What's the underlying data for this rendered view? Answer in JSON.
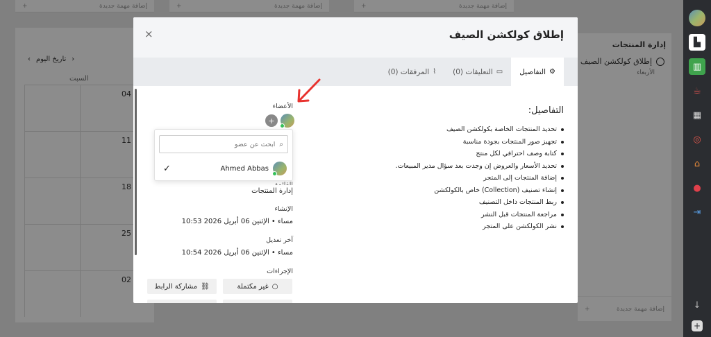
{
  "background": {
    "top_cards": [
      "إضافة مهمة جديدة",
      "إضافة مهمة جديدة",
      "إضافة مهمة جديدة"
    ],
    "calendar": {
      "today_label": "تاريخ اليوم",
      "day_header": "السبت",
      "dates": [
        "04",
        "11",
        "18",
        "25",
        "02"
      ]
    },
    "right_panel": {
      "title": "إدارة المنتجات",
      "task_title": "إطلاق كولكشن الصيف",
      "task_meta": "الأربعاء",
      "add_task": "إضافة مهمة جديدة"
    }
  },
  "sidebar": {
    "icons": [
      "avatar-icon",
      "dashboard-icon",
      "map-icon",
      "coffee-icon",
      "checkered-flag-icon",
      "target-icon",
      "house-icon",
      "pin-icon",
      "import-icon",
      "download-icon",
      "add-icon"
    ]
  },
  "modal": {
    "title": "إطلاق كولكشن الصيف",
    "close_symbol": "×",
    "tabs": [
      {
        "label": "التفاصيل",
        "icon": "gear-icon",
        "active": true
      },
      {
        "label": "التعليقات (0)",
        "icon": "comment-icon",
        "active": false
      },
      {
        "label": "المرفقات (0)",
        "icon": "paperclip-icon",
        "active": false
      }
    ],
    "details": {
      "title": "التفاصيل:",
      "items": [
        "تحديد المنتجات الخاصة بكولكشن الصيف",
        "تجهيز صور المنتجات بجودة مناسبة",
        "كتابة وصف احترافي لكل منتج",
        "تحديد الأسعار والعروض إن وجدت بعد سؤال مدير المبيعات.",
        "إضافة المنتجات إلى المتجر",
        "إنشاء تصنيف (Collection) خاص بالكولكشن",
        "ربط المنتجات داخل التصنيف",
        "مراجعة المنتجات قبل النشر",
        "نشر الكولكشن على المتجر"
      ]
    },
    "members": {
      "label": "الأعضاء",
      "add_symbol": "+"
    },
    "dropdown": {
      "search_placeholder": "ابحث عن عضو",
      "member_name": "Ahmed Abbas",
      "check_symbol": "✓"
    },
    "fields": {
      "partial_label": "القائمة",
      "list_value": "إدارة المنتجات",
      "created_label": "الإنشاء",
      "created_value": "10:53 مساء • الإثنين 06 أبريل 2026",
      "modified_label": "آخر تعديل",
      "modified_value": "10:54 مساء • الإثنين 06 أبريل 2026",
      "actions_label": "الإجراءات"
    },
    "actions": {
      "incomplete": "غير مكتملة",
      "share_link": "مشاركة الرابط"
    }
  },
  "colors": {
    "annotation_arrow": "#e8322e",
    "online_status": "#35c15a",
    "sidebar_bg": "#2b2d31"
  }
}
